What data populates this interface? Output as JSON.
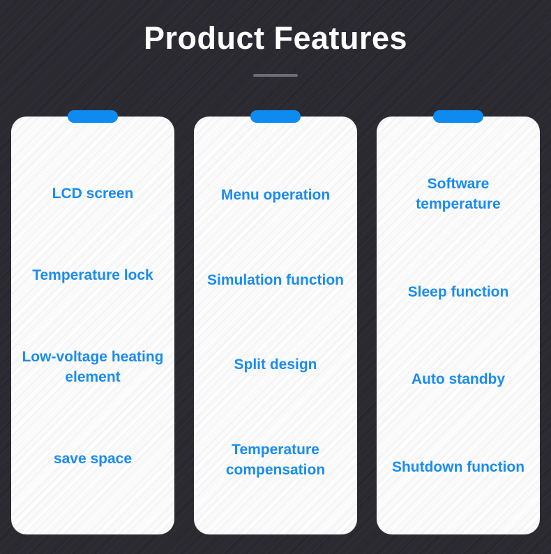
{
  "header": {
    "title": "Product Features"
  },
  "theme": {
    "background": "#2b2a31",
    "card_background": "#fafafa",
    "accent": "#0e8bf0",
    "feature_text": "#1a8cf0",
    "title_text": "#ffffff",
    "divider": "#6e6d75"
  },
  "columns": [
    {
      "features": [
        "LCD screen",
        "Temperature lock",
        "Low-voltage heating element",
        "save space"
      ]
    },
    {
      "features": [
        "Menu operation",
        "Simulation function",
        "Split design",
        "Temperature compensation"
      ]
    },
    {
      "features": [
        "Software temperature",
        "Sleep function",
        "Auto standby",
        "Shutdown function"
      ]
    }
  ]
}
